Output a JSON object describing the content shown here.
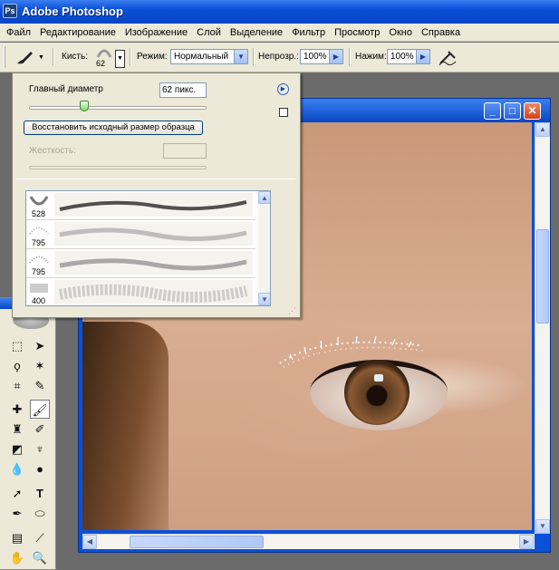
{
  "app": {
    "title": "Adobe Photoshop",
    "logo": "Ps"
  },
  "menu": [
    "Файл",
    "Редактирование",
    "Изображение",
    "Слой",
    "Выделение",
    "Фильтр",
    "Просмотр",
    "Окно",
    "Справка"
  ],
  "options": {
    "tool_icon": "brush-icon",
    "brush_label": "Кисть:",
    "brush_size": "62",
    "mode_label": "Режим:",
    "mode_value": "Нормальный",
    "opacity_label": "Непрозр.:",
    "opacity_value": "100%",
    "flow_label": "Нажим:",
    "flow_value": "100%",
    "airbrush_icon": "airbrush-icon"
  },
  "brush_popup": {
    "master_label": "Главный диаметр",
    "master_value": "62 пикс.",
    "master_fraction": 0.31,
    "restore_label": "Восстановить исходный размер образца",
    "hardness_label": "Жесткость:",
    "presets": [
      {
        "size": "528"
      },
      {
        "size": "795"
      },
      {
        "size": "795"
      },
      {
        "size": "400"
      }
    ]
  },
  "document": {
    "window_buttons": [
      "_",
      "□",
      "✕"
    ]
  },
  "colors": {
    "xp_blue": "#0a50d8",
    "chrome": "#ece9d8",
    "close_red": "#e2532a"
  }
}
